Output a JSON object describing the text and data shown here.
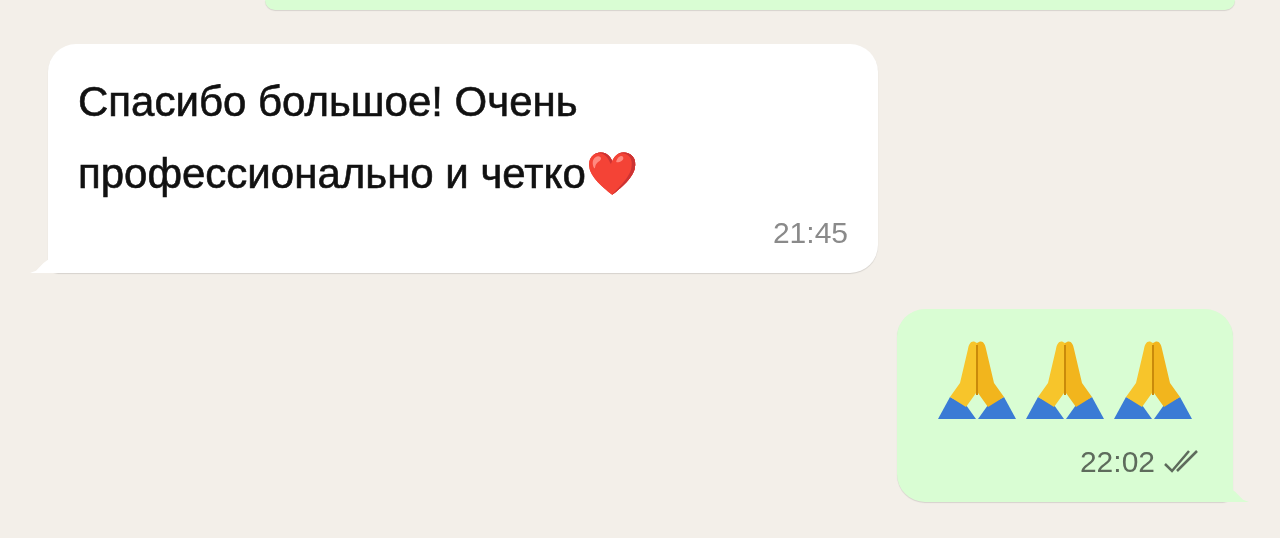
{
  "messages": [
    {
      "outgoing": true,
      "kind": "cut-off"
    },
    {
      "outgoing": false,
      "kind": "text",
      "text": "Спасибо большое! Очень профессионально и четко❤️",
      "time": "21:45"
    },
    {
      "outgoing": true,
      "kind": "emoji",
      "emojis": [
        {
          "kind": "praying-hands"
        },
        {
          "kind": "praying-hands"
        },
        {
          "kind": "praying-hands"
        }
      ],
      "time": "22:02",
      "read": false
    }
  ]
}
